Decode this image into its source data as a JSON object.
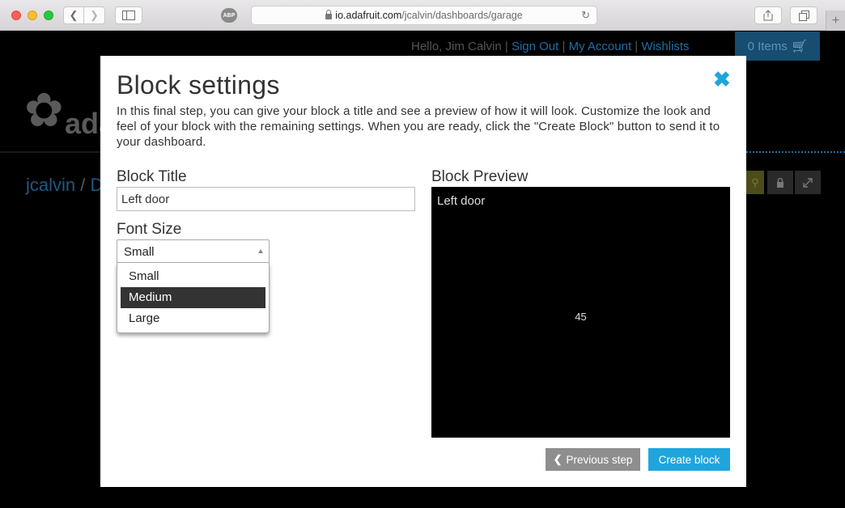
{
  "browser": {
    "url_domain": "io.adafruit.com",
    "url_path": "/jcalvin/dashboards/garage",
    "abp_label": "ABP",
    "icons": [
      "back-icon",
      "forward-icon",
      "sidebar-icon",
      "lock-icon",
      "reload-icon",
      "share-icon",
      "tabs-icon",
      "plus-icon"
    ]
  },
  "header": {
    "greeting": "Hello, Jim Calvin",
    "sep": "|",
    "sign_out": "Sign Out",
    "my_account": "My Account",
    "wishlists": "Wishlists",
    "cart_label": "0 Items"
  },
  "breadcrumb": {
    "user": "jcalvin",
    "sep": "/",
    "next_initial": "D"
  },
  "logo": {
    "text": "ada"
  },
  "modal": {
    "title": "Block settings",
    "close_glyph": "✖",
    "intro": "In this final step, you can give your block a title and see a preview of how it will look. Customize the look and feel of your block with the remaining settings. When you are ready, click the \"Create Block\" button to send it to your dashboard.",
    "block_title_label": "Block Title",
    "block_title_value": "Left door",
    "font_size_label": "Font Size",
    "font_size_selected": "Small",
    "font_size_options": [
      "Small",
      "Medium",
      "Large"
    ],
    "font_size_highlighted": "Medium",
    "preview_label": "Block Preview",
    "preview_title": "Left door",
    "preview_value": "45",
    "previous_button": "Previous step",
    "create_button": "Create block"
  },
  "colors": {
    "accent": "#1fa5dc",
    "link": "#1e6fa3",
    "highlight": "#333333",
    "secondary_button": "#8e8e8e"
  }
}
